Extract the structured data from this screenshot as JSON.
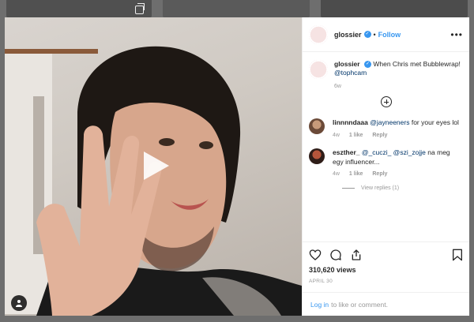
{
  "post": {
    "username": "glossier",
    "follow_label": "Follow",
    "separator": "•",
    "more_label": "•••",
    "caption_text": "When Chris met Bubblewrap!",
    "caption_mention": "@tophcam",
    "caption_age": "6w"
  },
  "comments": [
    {
      "username": "linnnndaaa",
      "mention": "@jayneeners",
      "text": "for your eyes lol",
      "age": "4w",
      "likes": "1 like",
      "reply_label": "Reply"
    },
    {
      "username": "eszther_",
      "mention": "@_cuczi_ @szi_zojje",
      "text": "na meg egy influencer...",
      "age": "4w",
      "likes": "1 like",
      "reply_label": "Reply"
    }
  ],
  "view_replies_label": "View replies (1)",
  "stats": {
    "views": "310,620 views",
    "date": "APRIL 30"
  },
  "login": {
    "link": "Log in",
    "text": "to like or comment."
  },
  "icons": {
    "like": "heart-icon",
    "comment": "comment-icon",
    "share": "share-icon",
    "save": "bookmark-icon",
    "play": "play-icon",
    "tag": "user-tag-icon",
    "gallery": "gallery-icon",
    "load_more": "plus-circle-icon"
  },
  "colors": {
    "accent": "#3897f0",
    "link": "#003569",
    "muted": "#999999",
    "verified": "#3897f0"
  }
}
